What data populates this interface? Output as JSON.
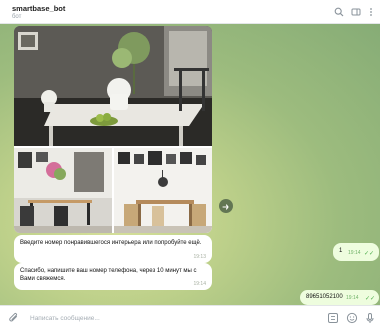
{
  "header": {
    "title": "smartbase_bot",
    "subtitle": "бот",
    "icons": [
      "search-icon",
      "sidebar-icon",
      "more-icon"
    ]
  },
  "messages": [
    {
      "direction": "in",
      "text": "Введите номер понравившегося интерьера или попробуйте ещё.",
      "time": "19:13"
    },
    {
      "direction": "out",
      "text": "1",
      "time": "19:14"
    },
    {
      "direction": "in",
      "text": "Спасибо, напишите ваш номер телефона, через 10 минут мы с Вами свяжемся.",
      "time": "19:14"
    },
    {
      "direction": "out",
      "text": "89651052100",
      "time": "19:14"
    }
  ],
  "composer": {
    "placeholder": "Написать сообщение...",
    "icons": [
      "paperclip-icon",
      "bot-commands-icon",
      "emoji-icon",
      "microphone-icon"
    ]
  },
  "colors": {
    "outgoing_bubble": "#eefdde",
    "incoming_bubble": "#ffffff",
    "read_checks": "#4fae4e",
    "wallpaper": "#b9cf88"
  }
}
